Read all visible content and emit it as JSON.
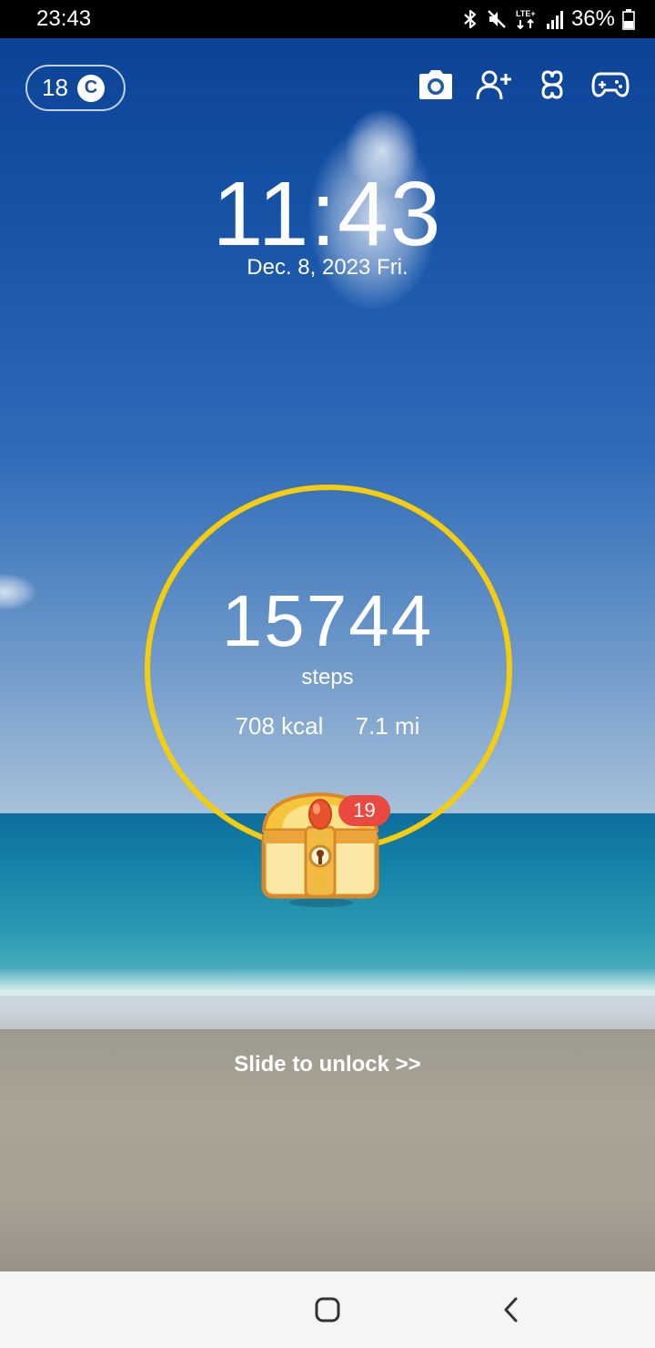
{
  "status_bar": {
    "time": "23:43",
    "battery_text": "36%",
    "network_label": "LTE+",
    "icons": [
      "bluetooth-icon",
      "mute-icon",
      "lte-icon",
      "signal-icon",
      "battery-icon"
    ]
  },
  "coins": {
    "count": "18",
    "icon_letter": "C"
  },
  "top_actions": [
    "camera-icon",
    "add-friend-icon",
    "clover-icon",
    "gamepad-icon"
  ],
  "clock": {
    "time": "11:43",
    "date": "Dec. 8, 2023 Fri."
  },
  "steps": {
    "count": "15744",
    "label": "steps",
    "calories": "708 kcal",
    "distance": "7.1 mi"
  },
  "chest": {
    "badge_count": "19"
  },
  "unlock_text": "Slide to unlock >>",
  "colors": {
    "ring": "#f4cd0f",
    "badge": "#e9493f",
    "sky": "#0a3f93",
    "nav_bar": "#f5f5f5"
  }
}
